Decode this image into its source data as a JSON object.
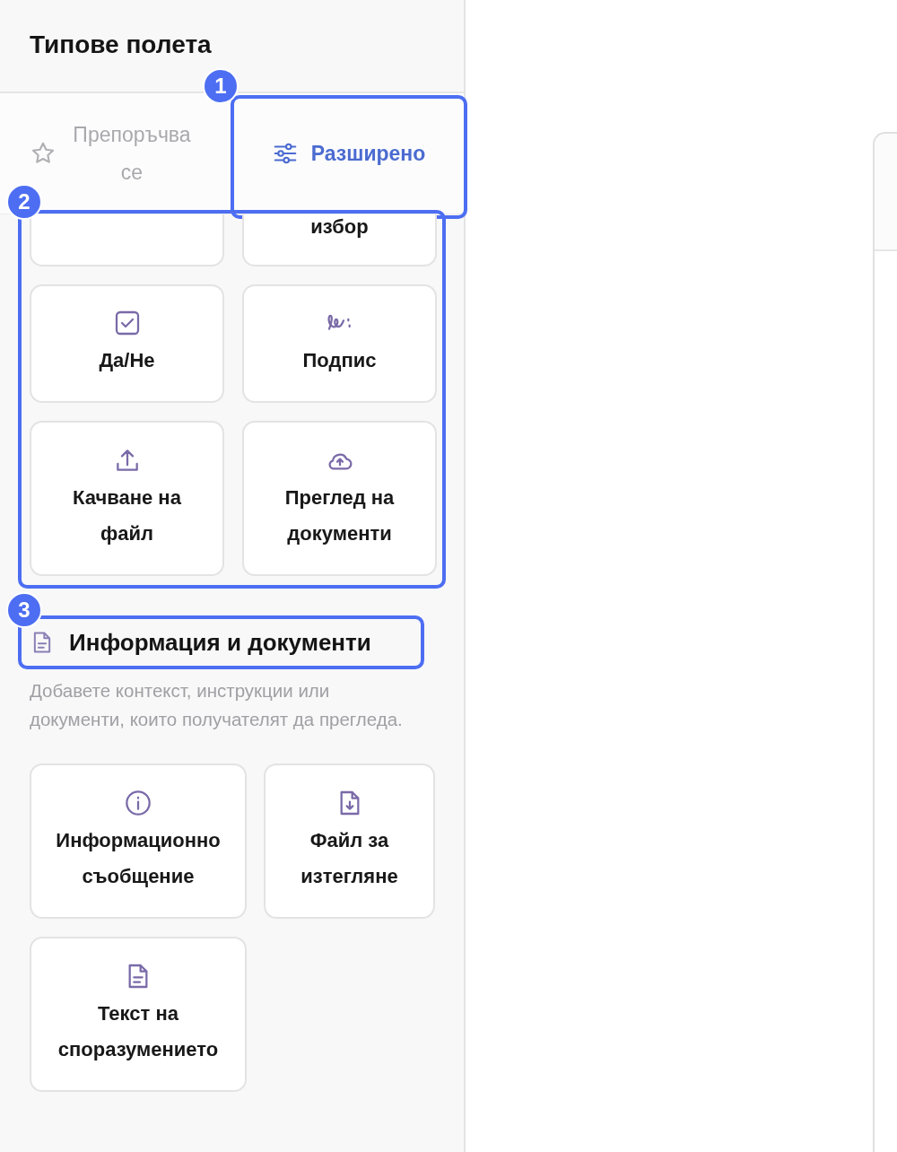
{
  "sidebar": {
    "title": "Типове полета",
    "tabs": [
      {
        "label": "Препоръчва се",
        "kind": "star",
        "selected": false
      },
      {
        "label": "Разширено",
        "kind": "sliders",
        "selected": true,
        "annotation": "1"
      }
    ],
    "sections": [
      {
        "annotation": "2",
        "fields": [
          {
            "kind": "cut"
          },
          {
            "kind": "cut",
            "label": "избор"
          },
          {
            "kind": "checkbox",
            "label": "Да/Не"
          },
          {
            "kind": "signature",
            "label": "Подпис"
          },
          {
            "kind": "upload",
            "label": "Качване на файл"
          },
          {
            "kind": "cloud",
            "label": "Преглед на документи"
          }
        ]
      },
      {
        "heading": "Информация и документи",
        "heading_annotation": "3",
        "description": "Добавете контекст, инструкции или документи, които получателят да прегледа.",
        "fields": [
          {
            "kind": "info",
            "label": "Информационно съобщение"
          },
          {
            "kind": "download",
            "label": "Файл за изтегляне"
          },
          {
            "kind": "document",
            "label": "Текст на споразумението"
          }
        ]
      }
    ]
  }
}
